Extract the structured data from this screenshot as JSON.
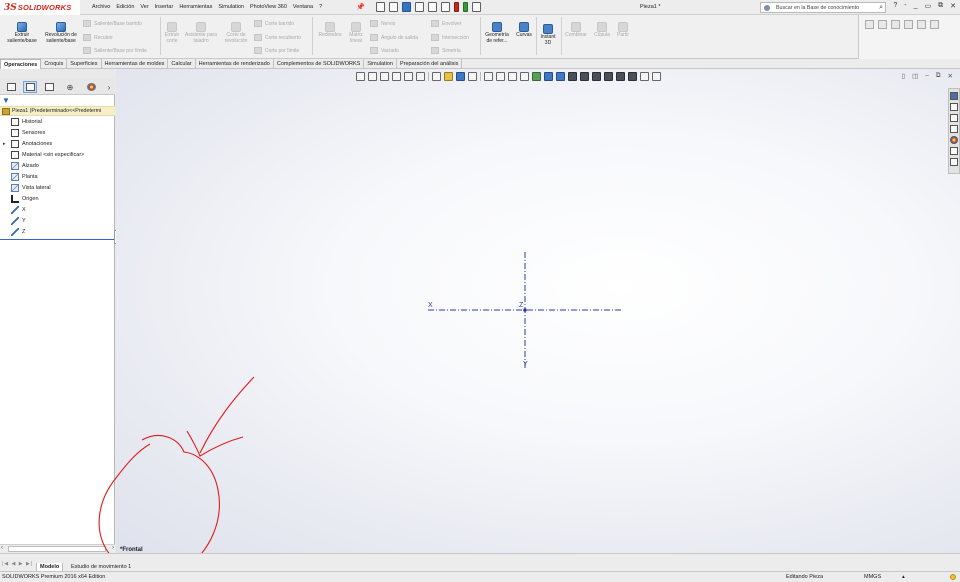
{
  "app": {
    "brand_logo": "3S",
    "brand_name": "SOLIDWORKS",
    "document_title": "Pieza1 *"
  },
  "menu": [
    "Archivo",
    "Edición",
    "Ver",
    "Insertar",
    "Herramientas",
    "Simulation",
    "PhotoView 360",
    "Ventana",
    "?"
  ],
  "search": {
    "placeholder": "Buscar en la Base de conocimiento"
  },
  "title_controls": [
    "?",
    "-",
    "_",
    "▭",
    "⧉",
    "✕"
  ],
  "ribbon": {
    "extrude_boss": "Extruir saliente/base",
    "revolve_boss": "Revolución de saliente/base",
    "swept_boss": "Saliente/Base barrido",
    "lofted_boss": "Recubrir",
    "boundary_boss": "Saliente/Base por límite",
    "extruded_cut": "Extruir corte",
    "hole_wizard": "Asistente para taladro",
    "revolved_cut": "Corte de revolución",
    "swept_cut": "Corte barrido",
    "lofted_cut": "Corte recubierto",
    "boundary_cut": "Corte por límite",
    "fillet": "Redondeo",
    "linear_pattern": "Matriz lineal",
    "rib": "Nervio",
    "draft": "Ángulo de salida",
    "shell": "Vaciado",
    "wrap": "Envolver",
    "intersect": "Intersección",
    "mirror": "Simetría",
    "ref_geometry": "Geometría de refer...",
    "curves": "Curvas",
    "instant3d": "Instant 3D",
    "combine": "Combinar",
    "dome": "Cúpula",
    "split": "Partir"
  },
  "command_tabs": [
    "Operaciones",
    "Croquis",
    "Superficies",
    "Herramientas de moldes",
    "Calcular",
    "Herramientas de renderizado",
    "Complementos de SOLIDWORKS",
    "Simulation",
    "Preparación del análisis"
  ],
  "active_command_tab": "Operaciones",
  "feature_tree": {
    "root": "Pieza1 (Predeterminado<<Predetermi",
    "items": [
      {
        "label": "Historial",
        "icon": "history-folder-icon"
      },
      {
        "label": "Sensores",
        "icon": "sensor-icon"
      },
      {
        "label": "Anotaciones",
        "icon": "annotation-icon"
      },
      {
        "label": "Material <sin especificar>",
        "icon": "material-icon"
      },
      {
        "label": "Alzado",
        "icon": "plane-icon"
      },
      {
        "label": "Planta",
        "icon": "plane-icon"
      },
      {
        "label": "Vista lateral",
        "icon": "plane-icon"
      },
      {
        "label": "Origen",
        "icon": "origin-icon"
      },
      {
        "label": "X",
        "icon": "axis-icon"
      },
      {
        "label": "Y",
        "icon": "axis-icon"
      },
      {
        "label": "Z",
        "icon": "axis-icon"
      }
    ]
  },
  "viewport": {
    "axis_x": "X",
    "axis_y": "Y",
    "axis_z": "Z",
    "view_name": "*Frontal",
    "axis_color": "#2c3aa8",
    "annotation_color": "#e01b1b"
  },
  "bottom_tabs": [
    "Modelo",
    "Estudio de movimiento 1"
  ],
  "active_bottom_tab": "Modelo",
  "status": {
    "edition": "SOLIDWORKS Premium 2016 x64 Edition",
    "mode": "Editando Pieza",
    "units": "MMGS"
  },
  "colors": {
    "brand_red": "#d62418",
    "selection_blue": "#3566c6",
    "background_gradient_edge": "#dfe2ec"
  }
}
